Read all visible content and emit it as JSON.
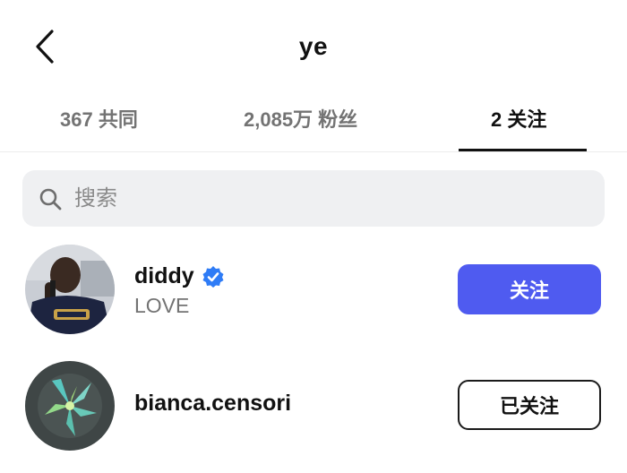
{
  "header": {
    "title": "ye",
    "back_icon": "chevron-left-icon"
  },
  "tabs": [
    {
      "label": "367 共同",
      "active": false
    },
    {
      "label": "2,085万 粉丝",
      "active": false
    },
    {
      "label": "2 关注",
      "active": true
    }
  ],
  "search": {
    "placeholder": "搜索",
    "value": "",
    "icon": "search-icon"
  },
  "following": [
    {
      "username": "diddy",
      "verified": true,
      "subtitle": "LOVE",
      "button_label": "关注",
      "button_state": "follow"
    },
    {
      "username": "bianca.censori",
      "verified": false,
      "subtitle": "",
      "button_label": "已关注",
      "button_state": "following"
    }
  ],
  "colors": {
    "accent": "#4f5bf0",
    "verified_badge": "#2f7cf6",
    "muted_text": "#737373",
    "search_bg": "#eff0f2"
  }
}
